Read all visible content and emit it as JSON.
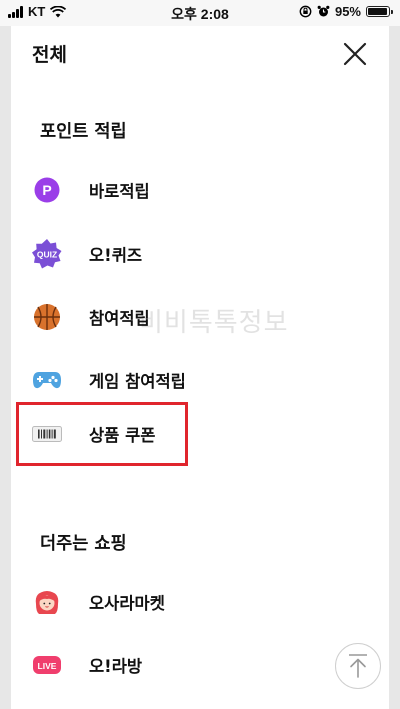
{
  "status_bar": {
    "carrier": "KT",
    "time": "오후 2:08",
    "battery": "95%",
    "battery_level": 0.95
  },
  "header": {
    "title": "전체",
    "close_icon": "close-icon"
  },
  "sections": [
    {
      "title": "포인트 적립",
      "items": [
        {
          "label": "바로적립",
          "icon": "p-point-icon",
          "icon_text": "P",
          "color": "#9a3ee8"
        },
        {
          "label": "오!퀴즈",
          "icon": "quiz-icon",
          "icon_text": "QUIZ",
          "color": "#7b4fd6"
        },
        {
          "label": "참여적립",
          "icon": "basketball-icon",
          "color": "#d9722c"
        },
        {
          "label": "게임 참여적립",
          "icon": "gamepad-icon",
          "color": "#4fa3e0"
        },
        {
          "label": "상품 쿠폰",
          "icon": "barcode-icon",
          "color": "#444444"
        }
      ]
    },
    {
      "title": "더주는 쇼핑",
      "items": [
        {
          "label": "오사라마켓",
          "icon": "market-girl-icon",
          "color": "#e8474f"
        },
        {
          "label": "오!라방",
          "icon": "live-icon",
          "icon_text": "LIVE",
          "color": "#f03e6d"
        }
      ]
    }
  ],
  "watermark": "비비톡톡정보",
  "scroll_top_icon": "arrow-up-icon"
}
